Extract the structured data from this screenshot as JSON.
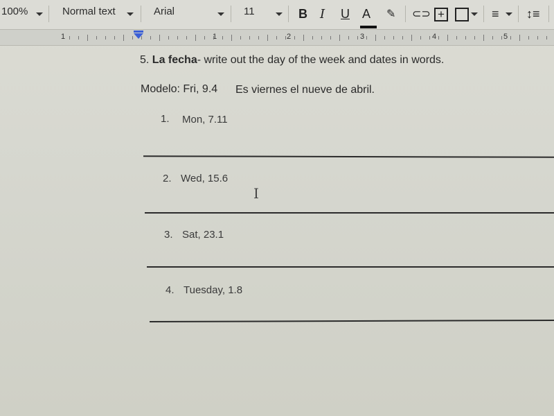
{
  "toolbar": {
    "zoom": "100%",
    "style": "Normal text",
    "font": "Arial",
    "font_size": "11",
    "icons": [
      "bold-icon",
      "italic-icon",
      "underline-icon",
      "text-color-icon",
      "highlight-icon",
      "link-icon",
      "comment-icon",
      "image-icon",
      "align-icon",
      "line-spacing-icon"
    ],
    "bold_glyph": "B",
    "italic_glyph": "I",
    "underline_glyph": "U",
    "text_color_glyph": "A",
    "text_color": "#111111"
  },
  "ruler": {
    "numbers": [
      "1",
      "1",
      "2",
      "3",
      "4",
      "5"
    ]
  },
  "document": {
    "heading_num": "5.",
    "heading_bold": "La fecha",
    "heading_rest": "- write out the day of the week and dates in words.",
    "model_label": "Modelo: Fri, 9.4",
    "model_answer": "Es viernes el nueve de abril.",
    "items": [
      {
        "num": "1.",
        "text": "Mon, 7.11"
      },
      {
        "num": "2.",
        "text": "Wed, 15.6"
      },
      {
        "num": "3.",
        "text": "Sat, 23.1"
      },
      {
        "num": "4.",
        "text": "Tuesday, 1.8"
      }
    ]
  }
}
